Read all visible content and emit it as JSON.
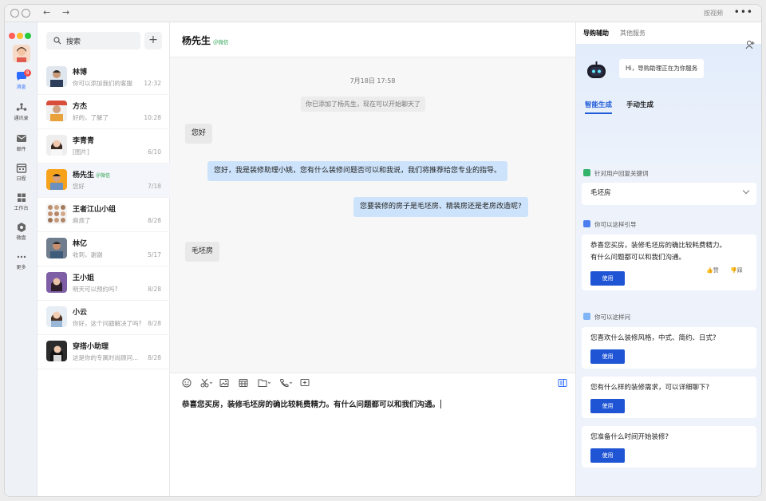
{
  "titlebar": {
    "title": "按视频"
  },
  "rail": {
    "badge_count": "8",
    "items": [
      {
        "label": "消息",
        "icon": "chat-icon"
      },
      {
        "label": "通讯录",
        "icon": "contacts-icon"
      },
      {
        "label": "邮件",
        "icon": "mail-icon"
      },
      {
        "label": "日程",
        "icon": "calendar-icon"
      },
      {
        "label": "工作台",
        "icon": "grid-icon"
      },
      {
        "label": "微盘",
        "icon": "drive-icon"
      },
      {
        "label": "更多",
        "icon": "more-icon"
      }
    ]
  },
  "search": {
    "placeholder": "搜索"
  },
  "conversations": [
    {
      "name": "林博",
      "tag": "",
      "preview": "你可以添加我们的客服",
      "time": "12:32"
    },
    {
      "name": "方杰",
      "tag": "",
      "preview": "好的，了解了",
      "time": "10:28"
    },
    {
      "name": "李青青",
      "tag": "",
      "preview": "[图片]",
      "time": "6/10"
    },
    {
      "name": "杨先生",
      "tag": "＠微信",
      "preview": "您好",
      "time": "7/18"
    },
    {
      "name": "王者江山小组",
      "tag": "",
      "preview": "麻烦了",
      "time": "8/28"
    },
    {
      "name": "林亿",
      "tag": "",
      "preview": "收到，谢谢",
      "time": "5/17"
    },
    {
      "name": "王小姐",
      "tag": "",
      "preview": "明天可以预约吗?",
      "time": "8/28"
    },
    {
      "name": "小云",
      "tag": "",
      "preview": "你好，这个问题解决了吗?",
      "time": "8/28"
    },
    {
      "name": "穿搭小助理",
      "tag": "",
      "preview": "这是你的专属时尚顾问...",
      "time": "8/28"
    }
  ],
  "chat": {
    "title": "杨先生",
    "tag": "＠微信",
    "timestamp": "7月18日  17:58",
    "system_note": "你已添加了杨先生，现在可以开始聊天了",
    "messages": [
      {
        "dir": "in",
        "text": "您好"
      },
      {
        "dir": "out",
        "text": "您好，我是装修助理小姚，您有什么装修问题否可以和我说，我们将推荐给您专业的指导。"
      },
      {
        "dir": "out",
        "text": "您要装修的房子是毛坯房、精装房还是老房改造呢?"
      },
      {
        "dir": "in",
        "text": "毛坯房"
      }
    ],
    "composer_text": "恭喜您买房，装修毛坯房的确比较耗费精力。有什么问题都可以和我们沟通。"
  },
  "assistant": {
    "tabs": [
      "导购辅助",
      "其他服务"
    ],
    "greeting": "Hi，导购助理正在为你服务",
    "modes": [
      "智能生成",
      "手动生成"
    ],
    "keyword_section": "针对用户回复关键词",
    "keyword_value": "毛坯房",
    "guide_section": "你可以这样引导",
    "guide_text_1": "恭喜您买房，装修毛坯房的确比较耗费精力。",
    "guide_text_2": "有什么问题都可以和我们沟通。",
    "use_label": "使用",
    "like_label": "赞",
    "dislike_label": "踩",
    "ask_section": "你可以这样问",
    "questions": [
      "您喜欢什么装修风格，中式、简约、日式?",
      "您有什么样的装修需求，可以详细聊下?",
      "您准备什么时间开始装修?"
    ]
  },
  "colors": {
    "accent": "#1f54d4",
    "wechat_green": "#2ca24f",
    "badge_red": "#f24c4c",
    "out_bubble": "#cde3fb"
  }
}
